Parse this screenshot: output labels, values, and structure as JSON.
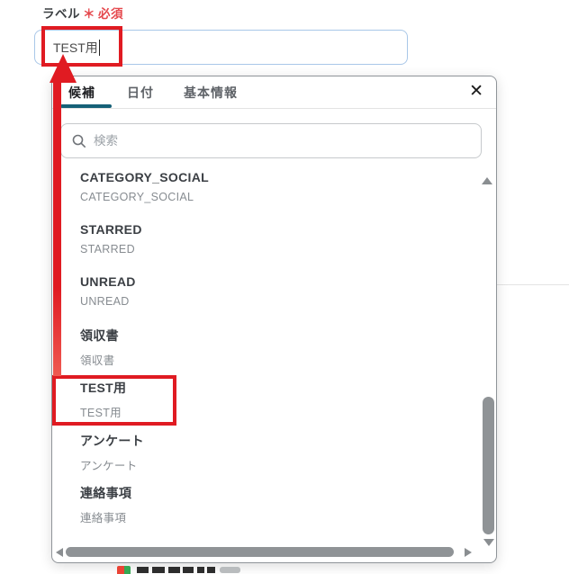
{
  "form": {
    "label": "ラベル",
    "required_mark": "＊",
    "required_text": "必須",
    "input_value": "TEST用"
  },
  "popup": {
    "tabs": [
      {
        "label": "候補",
        "active": true
      },
      {
        "label": "日付",
        "active": false
      },
      {
        "label": "基本情報",
        "active": false
      }
    ],
    "close_glyph": "✕",
    "search_placeholder": "検索",
    "items": [
      {
        "title": "CATEGORY_SOCIAL",
        "subtitle": "CATEGORY_SOCIAL"
      },
      {
        "title": "STARRED",
        "subtitle": "STARRED"
      },
      {
        "title": "UNREAD",
        "subtitle": "UNREAD"
      },
      {
        "title": "領収書",
        "subtitle": "領収書"
      },
      {
        "title": "TEST用",
        "subtitle": "TEST用",
        "highlighted": true
      },
      {
        "title": "アンケート",
        "subtitle": "アンケート"
      },
      {
        "title": "連絡事項",
        "subtitle": "連絡事項"
      }
    ]
  },
  "colors": {
    "accent_teal": "#156077",
    "annotation_red": "#e01b22",
    "required_red": "#e5484d",
    "input_border": "#a9c7e8"
  }
}
